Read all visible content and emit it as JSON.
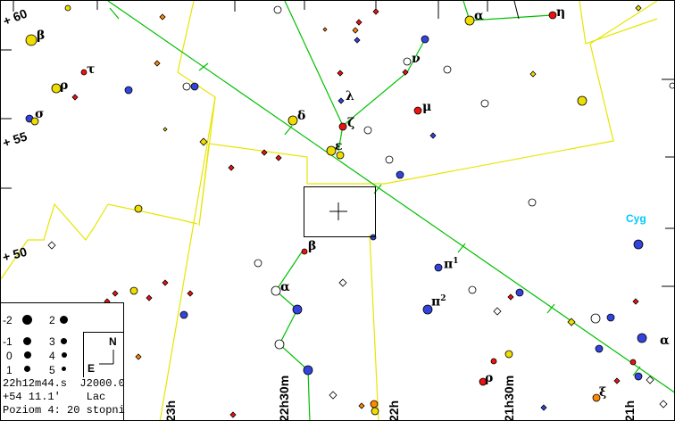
{
  "map": {
    "constellation_label": "Cyg",
    "dec_labels": [
      "+ 60",
      "+ 55",
      "+ 50"
    ],
    "ra_labels": [
      "23h",
      "22h30m",
      "22h",
      "21h30m",
      "21h"
    ],
    "star_names": {
      "alpha_top": "α",
      "eta": "η",
      "beta_left": "β",
      "tau": "τ",
      "rho_left": "ρ",
      "sigma": "σ",
      "nu": "ν",
      "lambda": "λ",
      "mu": "μ",
      "zeta": "ζ",
      "delta": "δ",
      "epsilon": "ε",
      "beta_lac": "β",
      "alpha_lac": "α",
      "pi": "π",
      "rho_low": "ρ",
      "xi": "ξ",
      "alpha_right": "α"
    },
    "pi1_sup": "1",
    "pi2_sup": "2"
  },
  "legend": {
    "magnitudes": [
      "-2",
      "-1",
      "0",
      "1",
      "2",
      "3",
      "4",
      "5"
    ],
    "compass_north": "N",
    "compass_east": "E"
  },
  "info": {
    "ra": "22h12m44.s",
    "epoch": "J2000.0",
    "dec": "+54 11.1'",
    "constellation": "Lac",
    "zoom": "Poziom 4: 20 stopni"
  },
  "colors": {
    "yellow_line": "#e8e800",
    "green_line": "#00c000",
    "red_star": "#ee1111",
    "blue_star": "#3344dd",
    "yellow_star": "#eedd00",
    "orange_star": "#ff8800",
    "white_star": "#ffffff"
  }
}
